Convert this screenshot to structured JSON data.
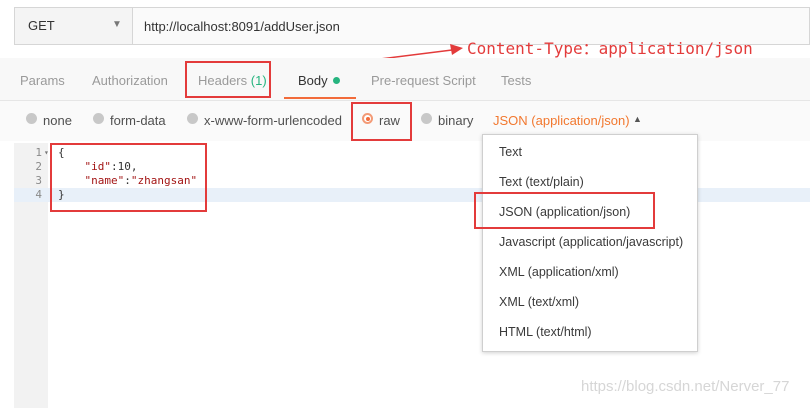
{
  "request": {
    "method": "GET",
    "url": "http://localhost:8091/addUser.json"
  },
  "annotation": "Content-Type：application/json",
  "tabs": [
    {
      "label": "Params"
    },
    {
      "label": "Authorization"
    },
    {
      "label": "Headers",
      "count": "(1)"
    },
    {
      "label": "Body"
    },
    {
      "label": "Pre-request Script"
    },
    {
      "label": "Tests"
    }
  ],
  "body_types": [
    {
      "label": "none"
    },
    {
      "label": "form-data"
    },
    {
      "label": "x-www-form-urlencoded"
    },
    {
      "label": "raw",
      "selected": true
    },
    {
      "label": "binary"
    }
  ],
  "content_type": "JSON (application/json)",
  "editor": {
    "line_numbers": [
      "1",
      "2",
      "3",
      "4"
    ],
    "line1": "{",
    "line2_key": "\"id\"",
    "line2_rest": ":10,",
    "line3_key": "\"name\"",
    "line3_colon": ":",
    "line3_value": "\"zhangsan\"",
    "line4": "}"
  },
  "dropdown_options": [
    "Text",
    "Text (text/plain)",
    "JSON (application/json)",
    "Javascript (application/javascript)",
    "XML (application/xml)",
    "XML (text/xml)",
    "HTML (text/html)"
  ],
  "watermark": "https://blog.csdn.net/Nerver_77",
  "colors": {
    "accent": "#f26b3a",
    "highlight": "#e33b3b",
    "status_green": "#26b47f"
  }
}
